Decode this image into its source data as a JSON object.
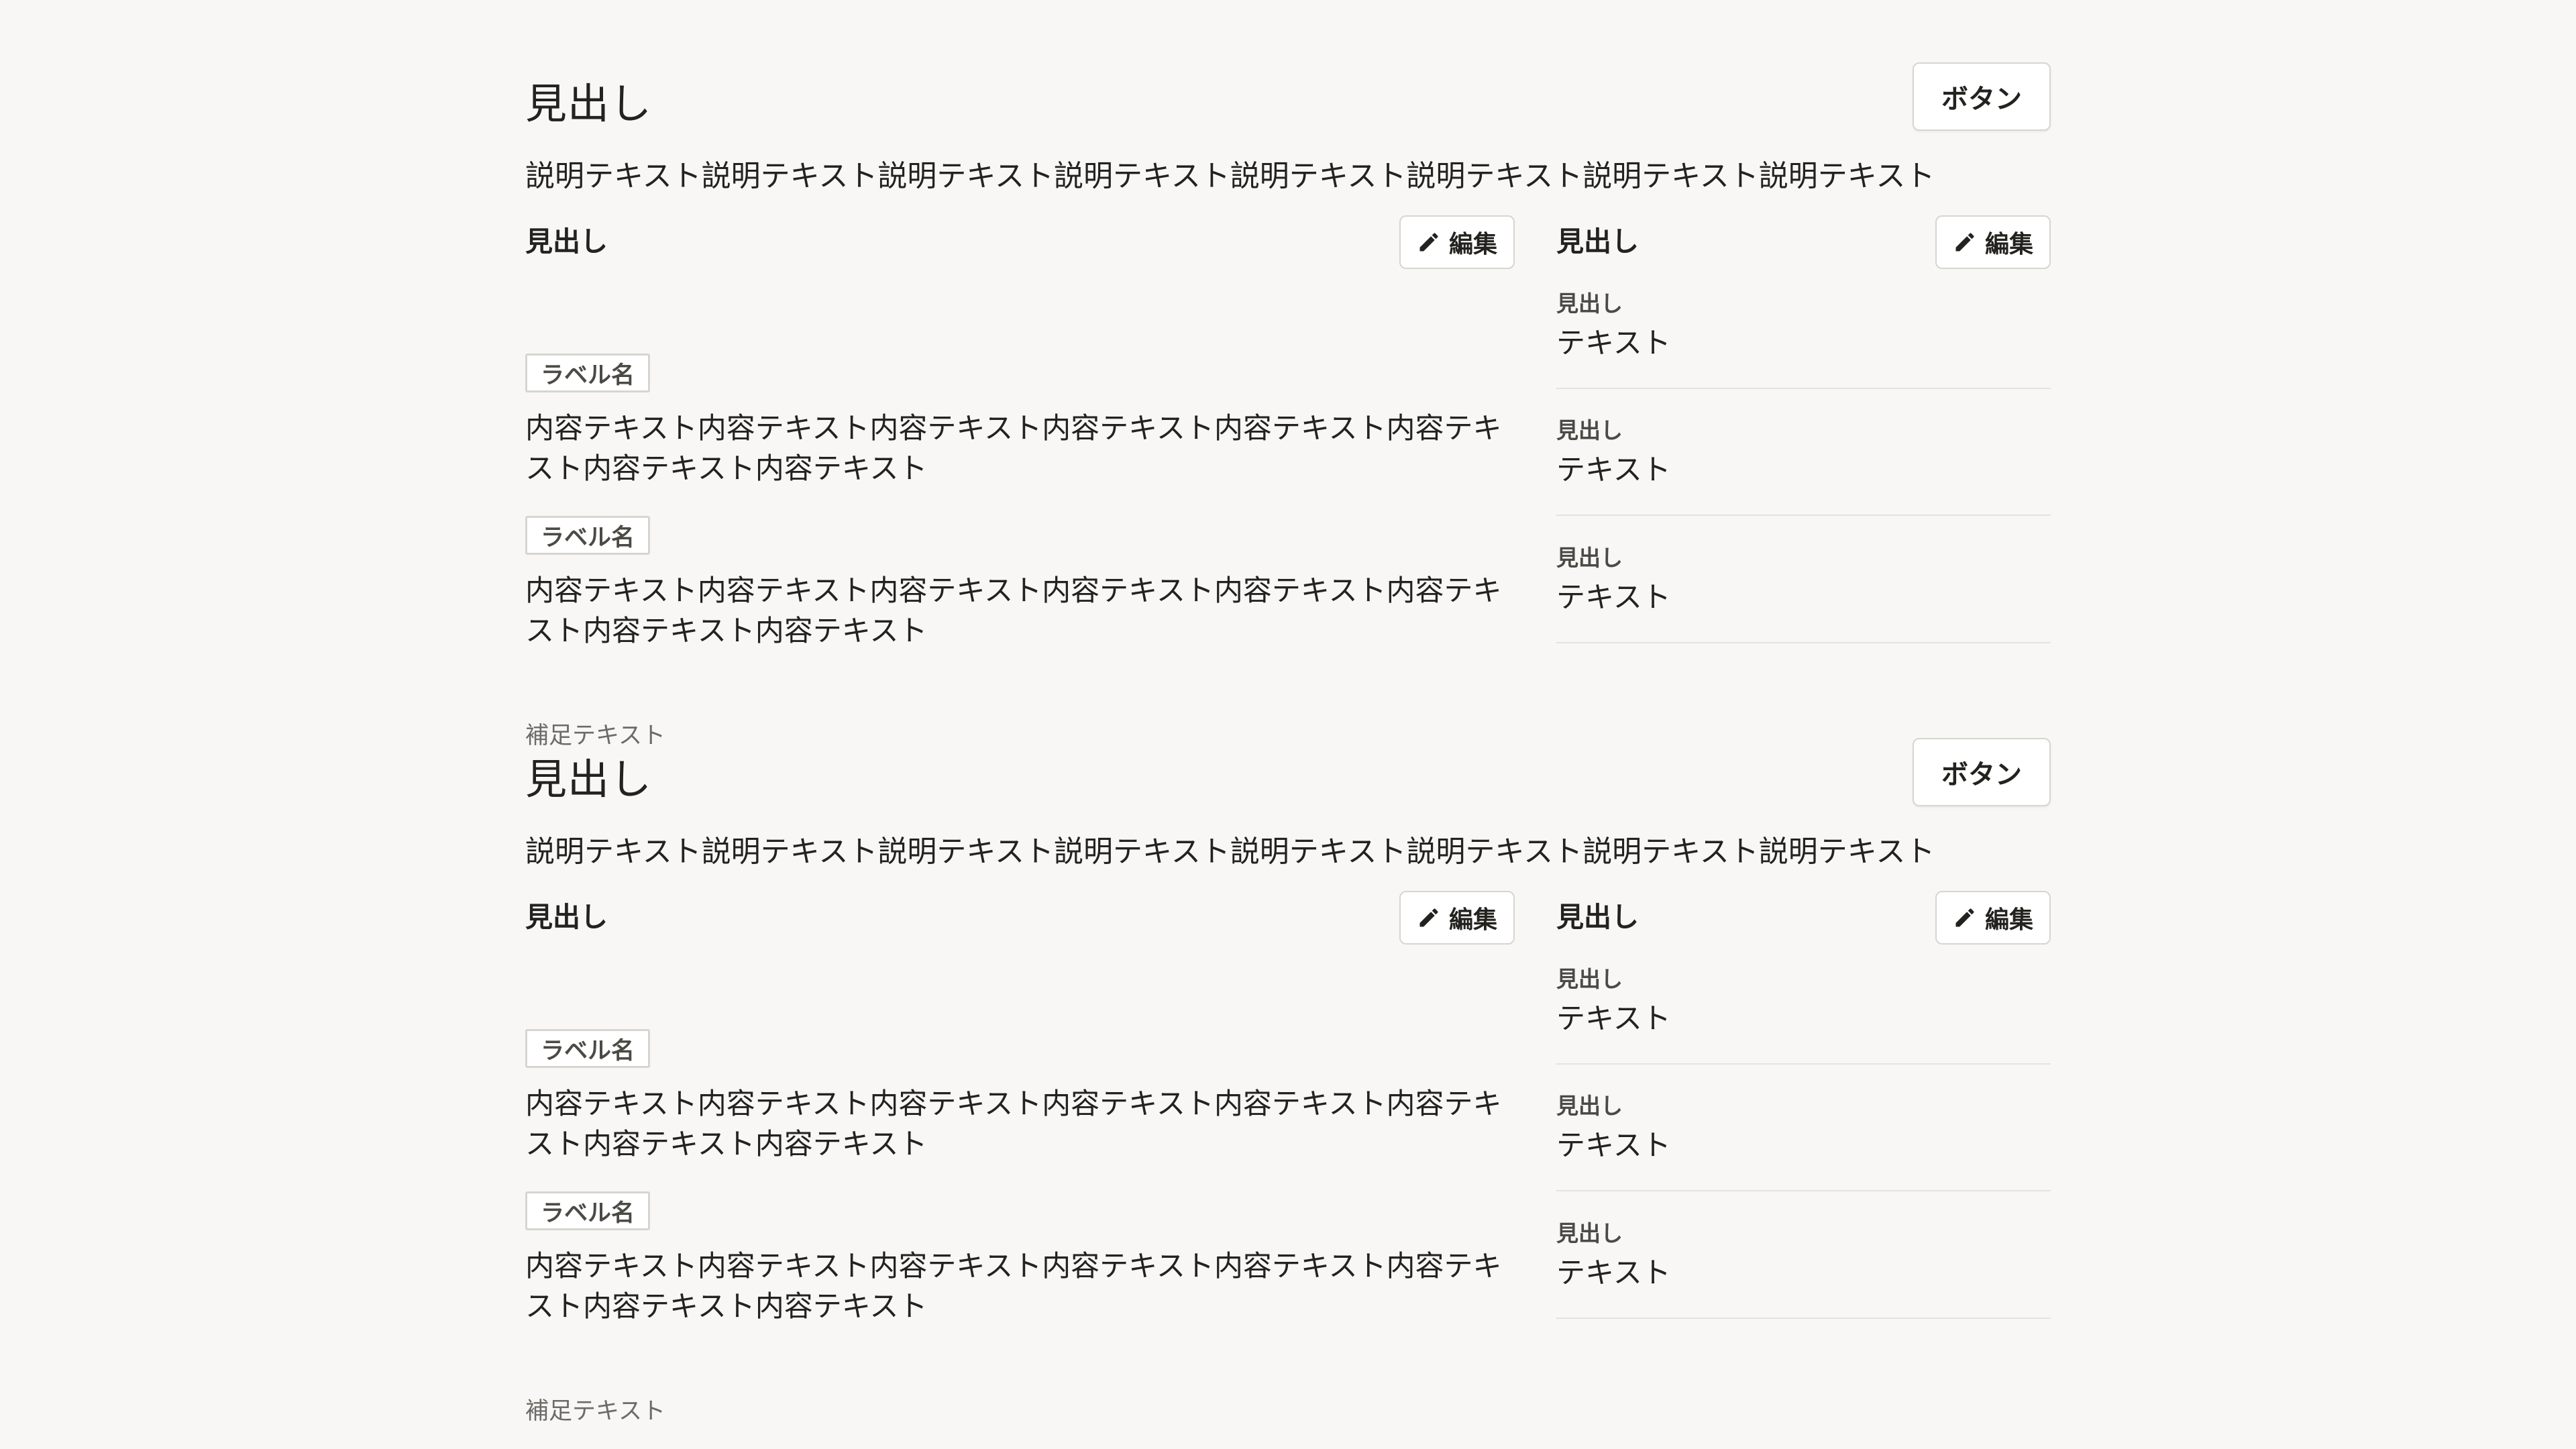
{
  "sections": [
    {
      "title": "見出し",
      "button_label": "ボタン",
      "description": "説明テキスト説明テキスト説明テキスト説明テキスト説明テキスト説明テキスト説明テキスト説明テキスト",
      "left_panel": {
        "title": "見出し",
        "edit_label": "編集",
        "items": [
          {
            "label": "ラベル名",
            "content": "内容テキスト内容テキスト内容テキスト内容テキスト内容テキスト内容テキスト内容テキスト内容テキスト"
          },
          {
            "label": "ラベル名",
            "content": "内容テキスト内容テキスト内容テキスト内容テキスト内容テキスト内容テキスト内容テキスト内容テキスト"
          }
        ]
      },
      "right_panel": {
        "title": "見出し",
        "edit_label": "編集",
        "fields": [
          {
            "label": "見出し",
            "value": "テキスト"
          },
          {
            "label": "見出し",
            "value": "テキスト"
          },
          {
            "label": "見出し",
            "value": "テキスト"
          }
        ]
      },
      "supplement": "補足テキスト"
    },
    {
      "title": "見出し",
      "button_label": "ボタン",
      "description": "説明テキスト説明テキスト説明テキスト説明テキスト説明テキスト説明テキスト説明テキスト説明テキスト",
      "left_panel": {
        "title": "見出し",
        "edit_label": "編集",
        "items": [
          {
            "label": "ラベル名",
            "content": "内容テキスト内容テキスト内容テキスト内容テキスト内容テキスト内容テキスト内容テキスト内容テキスト"
          },
          {
            "label": "ラベル名",
            "content": "内容テキスト内容テキスト内容テキスト内容テキスト内容テキスト内容テキスト内容テキスト内容テキスト"
          }
        ]
      },
      "right_panel": {
        "title": "見出し",
        "edit_label": "編集",
        "fields": [
          {
            "label": "見出し",
            "value": "テキスト"
          },
          {
            "label": "見出し",
            "value": "テキスト"
          },
          {
            "label": "見出し",
            "value": "テキスト"
          }
        ]
      },
      "supplement": "補足テキスト"
    }
  ],
  "icons": {
    "edit": "pencil-icon"
  },
  "colors": {
    "background": "#f8f7f5",
    "text": "#23221e",
    "border": "#d6d5d1",
    "muted_text": "#6c6b66"
  }
}
